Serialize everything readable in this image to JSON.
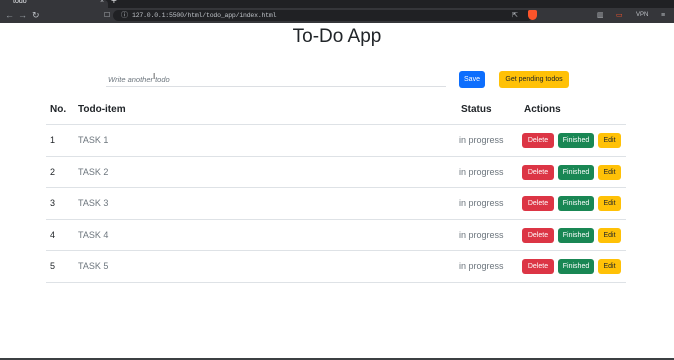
{
  "browser": {
    "tab_title": "todo",
    "tab_close": "×",
    "tab_new": "+",
    "url": "127.0.0.1:5500/html/todo_app/index.html",
    "vpn_label": "VPN",
    "icons": {
      "back": "←",
      "forward": "→",
      "reload": "↻",
      "bookmark": "☐",
      "info": "ⓘ",
      "share": "⇱",
      "menu": "≡",
      "sidebar": "▥",
      "wallet": "▭"
    }
  },
  "page": {
    "title": "To-Do App",
    "input": {
      "placeholder": "Write another todo"
    },
    "save_label": "Save",
    "pending_label": "Get pending todos"
  },
  "table": {
    "headers": {
      "no": "No.",
      "item": "Todo-item",
      "status": "Status",
      "actions": "Actions"
    },
    "rows": [
      {
        "no": "1",
        "task": "TASK 1",
        "status": "in progress"
      },
      {
        "no": "2",
        "task": "TASK 2",
        "status": "in progress"
      },
      {
        "no": "3",
        "task": "TASK 3",
        "status": "in progress"
      },
      {
        "no": "4",
        "task": "TASK 4",
        "status": "in progress"
      },
      {
        "no": "5",
        "task": "TASK 5",
        "status": "in progress"
      }
    ],
    "actions": {
      "delete": "Delete",
      "finished": "Finished",
      "edit": "Edit"
    }
  },
  "colors": {
    "save": "#0d6efd",
    "warning": "#ffc107",
    "danger": "#dc3545",
    "success": "#198754"
  }
}
